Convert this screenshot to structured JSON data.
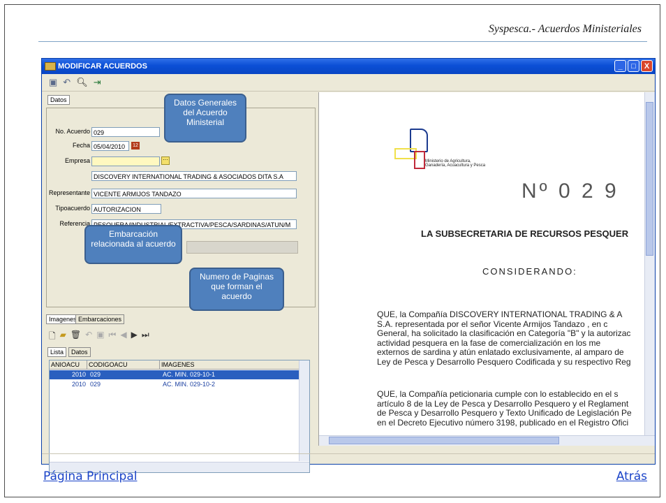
{
  "slide": {
    "title": "Syspesca.- Acuerdos Ministeriales",
    "link_left": "Página Principal",
    "link_right": "Atrás"
  },
  "window": {
    "title": "MODIFICAR ACUERDOS",
    "buttons": [
      "_",
      "□",
      "X"
    ]
  },
  "form": {
    "tab_datos": "Datos",
    "no_acuerdo_label": "No. Acuerdo",
    "no_acuerdo_value": "029",
    "fecha_label": "Fecha",
    "fecha_value": "05/04/2010",
    "empresa_label": "Empresa",
    "empresa_value": "DISCOVERY INTERNATIONAL TRADING & ASOCIADOS DITA S.A",
    "representante_label": "Representante",
    "representante_value": "VICENTE ARMIJOS TANDAZO",
    "tipoacuerdo_label": "Tipoacuerdo",
    "tipoacuerdo_value": "AUTORIZACION",
    "referencia_label": "Referencia",
    "referencia_value": "PESQUERA/INDUSTRIAL/EXTRACTIVA/PESCA/SARDINAS/ATUN/M"
  },
  "callouts": {
    "datos": "Datos Generales del Acuerdo Ministerial",
    "embarcacion": "Embarcación relacionada al acuerdo",
    "paginas": "Numero de Paginas que forman el acuerdo"
  },
  "lower": {
    "tab_imagenes": "Imagenes",
    "tab_embarcaciones": "Embarcaciones",
    "subtab_lista": "Lista",
    "subtab_datos": "Datos",
    "columns": [
      "ANIOACU",
      "CODIGOACU",
      "IMAGENES"
    ],
    "rows": [
      {
        "anio": "2010",
        "codigo": "029",
        "imagen": "AC. MIN. 029-10-1",
        "selected": true
      },
      {
        "anio": "2010",
        "codigo": "029",
        "imagen": "AC. MIN. 029-10-2",
        "selected": false
      }
    ]
  },
  "document": {
    "ministry": "Ministerio de Agricultura, Ganadería, Acuacultura y Pesca",
    "number": "Nº 0 2 9",
    "heading": "LA SUBSECRETARIA DE RECURSOS PESQUER",
    "considerando": "CONSIDERANDO:",
    "para1": [
      "QUE, la Compañía DISCOVERY INTERNATIONAL TRADING & A",
      "S.A.   representada por el señor Vicente Armijos Tandazo  , en c",
      "General, ha solicitado la clasificación en Categoría \"B\" y la autorizac",
      "actividad pesquera en la fase  de  comercialización en los me",
      "externos de sardina y atún enlatado exclusivamente, al amparo de",
      "Ley de Pesca y Desarrollo Pesquero Codificada y su respectivo Reg"
    ],
    "para2": [
      "QUE, la Compañía peticionaria cumple con lo establecido en el s",
      "artículo 8 de la Ley de Pesca y Desarrollo Pesquero y el Reglament",
      "de Pesca y Desarrollo Pesquero y Texto Unificado de Legislación Pe",
      "en el Decreto Ejecutivo número 3198, publicado en el Registro Ofici"
    ]
  }
}
